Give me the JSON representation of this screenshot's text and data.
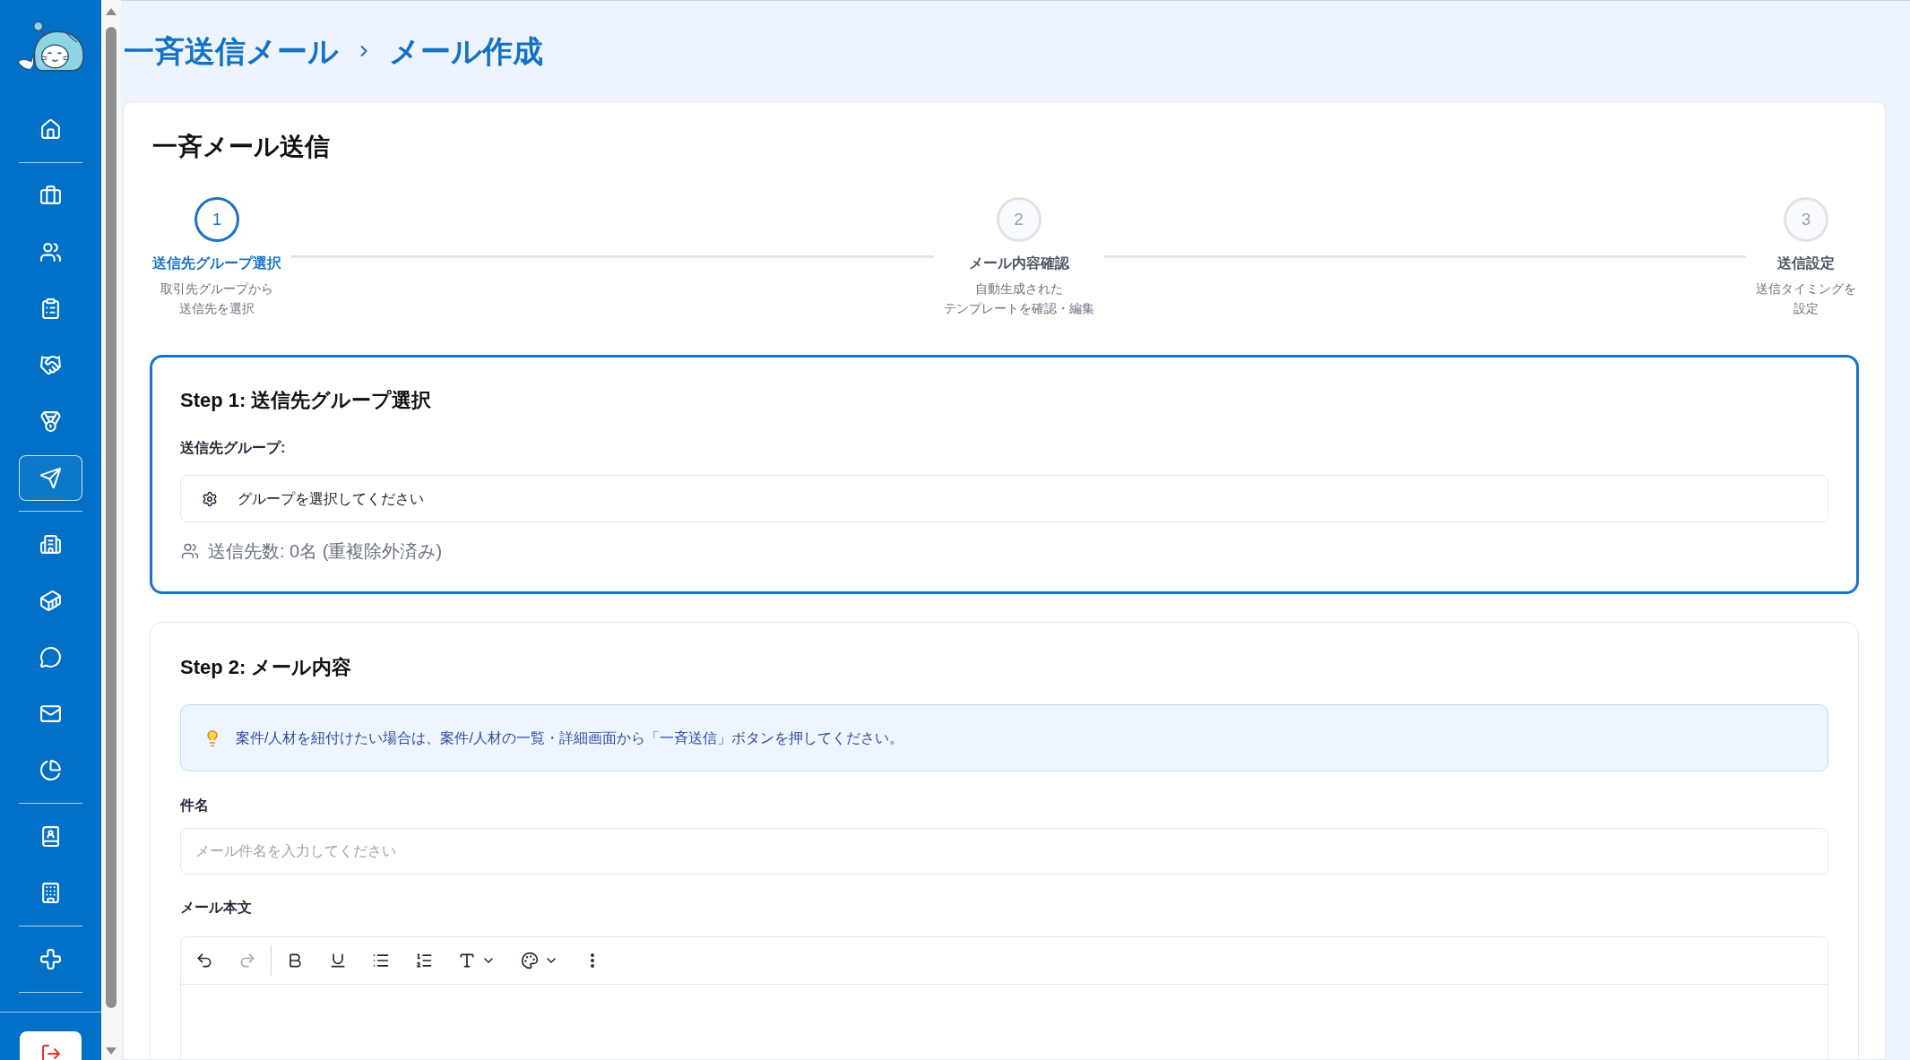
{
  "header": {
    "breadcrumb": [
      "一斉送信メール",
      "メール作成"
    ]
  },
  "sidebar": {
    "groups": [
      [
        {
          "kind": "home",
          "selected": false
        }
      ],
      [
        {
          "kind": "briefcase",
          "selected": false
        },
        {
          "kind": "users",
          "selected": false
        },
        {
          "kind": "clipboard",
          "selected": false
        },
        {
          "kind": "handshake",
          "selected": false
        },
        {
          "kind": "medal",
          "selected": false
        },
        {
          "kind": "send",
          "selected": true
        }
      ],
      [
        {
          "kind": "building",
          "selected": false
        },
        {
          "kind": "container",
          "selected": false
        },
        {
          "kind": "chat",
          "selected": false
        },
        {
          "kind": "mail",
          "selected": false
        },
        {
          "kind": "pie",
          "selected": false
        }
      ],
      [
        {
          "kind": "contact",
          "selected": false
        },
        {
          "kind": "office",
          "selected": false
        }
      ],
      [
        {
          "kind": "plus",
          "selected": false
        }
      ]
    ]
  },
  "card": {
    "title": "一斉メール送信"
  },
  "stepper": [
    {
      "number": "1",
      "label": "送信先グループ選択",
      "description": [
        "取引先グループから",
        "送信先を選択"
      ],
      "selected": true
    },
    {
      "number": "2",
      "label": "メール内容確認",
      "description": [
        "自動生成された",
        "テンプレートを確認・編集"
      ],
      "selected": false
    },
    {
      "number": "3",
      "label": "送信設定",
      "description": [
        "送信タイミングを",
        "設定"
      ],
      "selected": false
    }
  ],
  "step1": {
    "title": "Step 1: 送信先グループ選択",
    "active": true,
    "group_label": "送信先グループ:",
    "group_select": {
      "text": "グループを選択してください"
    },
    "recipient_count": "送信先数: 0名 (重複除外済み)"
  },
  "step2": {
    "title": "Step 2: メール内容",
    "active": false,
    "notice": "案件/人材を紐付けたい場合は、案件/人材の一覧・詳細画面から「一斉送信」ボタンを押してください。",
    "subject": {
      "label": "件名",
      "placeholder": "メール件名を入力してください"
    },
    "body": {
      "label": "メール本文",
      "toolbar": {
        "history": [
          {
            "kind": "undo",
            "disabled": false
          },
          {
            "kind": "redo",
            "disabled": true
          }
        ],
        "format": [
          {
            "kind": "bold",
            "disabled": false
          },
          {
            "kind": "underline",
            "disabled": false
          },
          {
            "kind": "bullet_list",
            "disabled": false
          },
          {
            "kind": "ordered_list",
            "disabled": false
          },
          {
            "kind": "text_style",
            "disabled": false
          },
          {
            "kind": "color",
            "disabled": false
          },
          {
            "kind": "more",
            "disabled": false
          }
        ]
      }
    }
  }
}
